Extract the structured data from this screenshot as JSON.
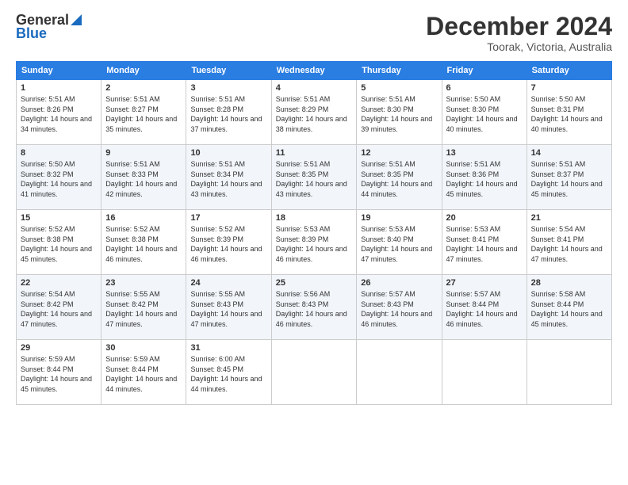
{
  "header": {
    "logo_general": "General",
    "logo_blue": "Blue",
    "month_title": "December 2024",
    "location": "Toorak, Victoria, Australia"
  },
  "calendar": {
    "weekdays": [
      "Sunday",
      "Monday",
      "Tuesday",
      "Wednesday",
      "Thursday",
      "Friday",
      "Saturday"
    ],
    "weeks": [
      [
        {
          "day": "1",
          "sunrise": "5:51 AM",
          "sunset": "8:26 PM",
          "daylight": "14 hours and 34 minutes."
        },
        {
          "day": "2",
          "sunrise": "5:51 AM",
          "sunset": "8:27 PM",
          "daylight": "14 hours and 35 minutes."
        },
        {
          "day": "3",
          "sunrise": "5:51 AM",
          "sunset": "8:28 PM",
          "daylight": "14 hours and 37 minutes."
        },
        {
          "day": "4",
          "sunrise": "5:51 AM",
          "sunset": "8:29 PM",
          "daylight": "14 hours and 38 minutes."
        },
        {
          "day": "5",
          "sunrise": "5:51 AM",
          "sunset": "8:30 PM",
          "daylight": "14 hours and 39 minutes."
        },
        {
          "day": "6",
          "sunrise": "5:50 AM",
          "sunset": "8:30 PM",
          "daylight": "14 hours and 40 minutes."
        },
        {
          "day": "7",
          "sunrise": "5:50 AM",
          "sunset": "8:31 PM",
          "daylight": "14 hours and 40 minutes."
        }
      ],
      [
        {
          "day": "8",
          "sunrise": "5:50 AM",
          "sunset": "8:32 PM",
          "daylight": "14 hours and 41 minutes."
        },
        {
          "day": "9",
          "sunrise": "5:51 AM",
          "sunset": "8:33 PM",
          "daylight": "14 hours and 42 minutes."
        },
        {
          "day": "10",
          "sunrise": "5:51 AM",
          "sunset": "8:34 PM",
          "daylight": "14 hours and 43 minutes."
        },
        {
          "day": "11",
          "sunrise": "5:51 AM",
          "sunset": "8:35 PM",
          "daylight": "14 hours and 43 minutes."
        },
        {
          "day": "12",
          "sunrise": "5:51 AM",
          "sunset": "8:35 PM",
          "daylight": "14 hours and 44 minutes."
        },
        {
          "day": "13",
          "sunrise": "5:51 AM",
          "sunset": "8:36 PM",
          "daylight": "14 hours and 45 minutes."
        },
        {
          "day": "14",
          "sunrise": "5:51 AM",
          "sunset": "8:37 PM",
          "daylight": "14 hours and 45 minutes."
        }
      ],
      [
        {
          "day": "15",
          "sunrise": "5:52 AM",
          "sunset": "8:38 PM",
          "daylight": "14 hours and 45 minutes."
        },
        {
          "day": "16",
          "sunrise": "5:52 AM",
          "sunset": "8:38 PM",
          "daylight": "14 hours and 46 minutes."
        },
        {
          "day": "17",
          "sunrise": "5:52 AM",
          "sunset": "8:39 PM",
          "daylight": "14 hours and 46 minutes."
        },
        {
          "day": "18",
          "sunrise": "5:53 AM",
          "sunset": "8:39 PM",
          "daylight": "14 hours and 46 minutes."
        },
        {
          "day": "19",
          "sunrise": "5:53 AM",
          "sunset": "8:40 PM",
          "daylight": "14 hours and 47 minutes."
        },
        {
          "day": "20",
          "sunrise": "5:53 AM",
          "sunset": "8:41 PM",
          "daylight": "14 hours and 47 minutes."
        },
        {
          "day": "21",
          "sunrise": "5:54 AM",
          "sunset": "8:41 PM",
          "daylight": "14 hours and 47 minutes."
        }
      ],
      [
        {
          "day": "22",
          "sunrise": "5:54 AM",
          "sunset": "8:42 PM",
          "daylight": "14 hours and 47 minutes."
        },
        {
          "day": "23",
          "sunrise": "5:55 AM",
          "sunset": "8:42 PM",
          "daylight": "14 hours and 47 minutes."
        },
        {
          "day": "24",
          "sunrise": "5:55 AM",
          "sunset": "8:43 PM",
          "daylight": "14 hours and 47 minutes."
        },
        {
          "day": "25",
          "sunrise": "5:56 AM",
          "sunset": "8:43 PM",
          "daylight": "14 hours and 46 minutes."
        },
        {
          "day": "26",
          "sunrise": "5:57 AM",
          "sunset": "8:43 PM",
          "daylight": "14 hours and 46 minutes."
        },
        {
          "day": "27",
          "sunrise": "5:57 AM",
          "sunset": "8:44 PM",
          "daylight": "14 hours and 46 minutes."
        },
        {
          "day": "28",
          "sunrise": "5:58 AM",
          "sunset": "8:44 PM",
          "daylight": "14 hours and 45 minutes."
        }
      ],
      [
        {
          "day": "29",
          "sunrise": "5:59 AM",
          "sunset": "8:44 PM",
          "daylight": "14 hours and 45 minutes."
        },
        {
          "day": "30",
          "sunrise": "5:59 AM",
          "sunset": "8:44 PM",
          "daylight": "14 hours and 44 minutes."
        },
        {
          "day": "31",
          "sunrise": "6:00 AM",
          "sunset": "8:45 PM",
          "daylight": "14 hours and 44 minutes."
        },
        null,
        null,
        null,
        null
      ]
    ]
  }
}
